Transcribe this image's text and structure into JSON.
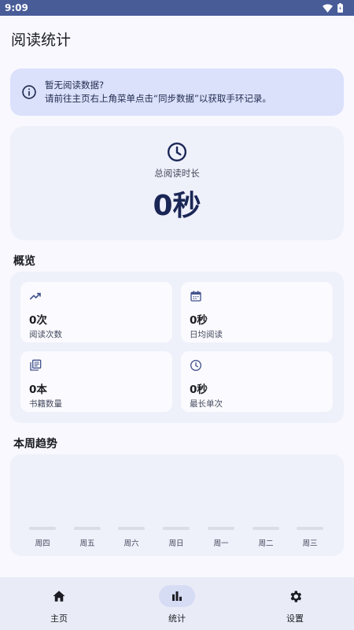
{
  "status_bar": {
    "time": "9:09"
  },
  "page": {
    "title": "阅读统计"
  },
  "notice": {
    "line1": "暂无阅读数据?",
    "line2": "请前往主页右上角菜单点击“同步数据”以获取手环记录。"
  },
  "total": {
    "label": "总阅读时长",
    "value": "0秒"
  },
  "overview": {
    "title": "概览",
    "cards": [
      {
        "icon": "trending-up-icon",
        "value": "0次",
        "label": "阅读次数"
      },
      {
        "icon": "calendar-icon",
        "value": "0秒",
        "label": "日均阅读"
      },
      {
        "icon": "library-books-icon",
        "value": "0本",
        "label": "书籍数量"
      },
      {
        "icon": "clock-icon",
        "value": "0秒",
        "label": "最长单次"
      }
    ]
  },
  "weekly": {
    "title": "本周趋势",
    "days": [
      "周四",
      "周五",
      "周六",
      "周日",
      "周一",
      "周二",
      "周三"
    ],
    "values": [
      0,
      0,
      0,
      0,
      0,
      0,
      0
    ]
  },
  "nav": {
    "items": [
      {
        "icon": "home-icon",
        "label": "主页"
      },
      {
        "icon": "bar-chart-icon",
        "label": "统计",
        "active": true
      },
      {
        "icon": "gear-icon",
        "label": "设置"
      }
    ]
  },
  "colors": {
    "status_bar": "#485c98",
    "accent": "#1a2655",
    "notice_bg": "#dbe1fb",
    "card_bg": "#eef0fa"
  }
}
